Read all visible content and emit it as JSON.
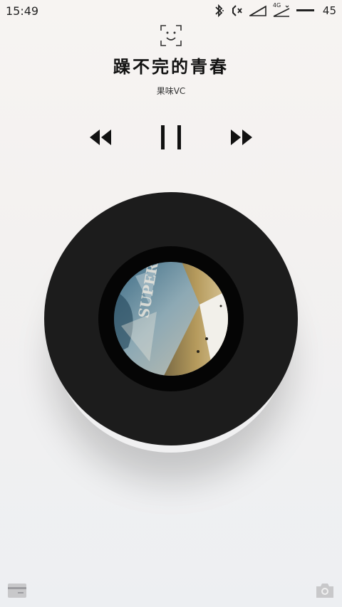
{
  "status_bar": {
    "time": "15:49",
    "signal_label": "4G",
    "battery": "45",
    "icons": [
      "bluetooth-icon",
      "mute-icon",
      "signal-icon",
      "signal-4g-icon",
      "battery-icon"
    ]
  },
  "header": {
    "icon": "face-icon"
  },
  "song": {
    "title": "躁不完的青春",
    "artist": "果味VC"
  },
  "controls": {
    "prev_icon": "rewind-icon",
    "play_state_icon": "pause-icon",
    "next_icon": "fast-forward-icon"
  },
  "disc": {
    "art_icon": "album-art",
    "art_text": "SUPERCO"
  },
  "bottom": {
    "left_icon": "wallet-icon",
    "right_icon": "camera-icon"
  },
  "colors": {
    "disc": "#1c1c1c",
    "disc_ring": "#050505",
    "text": "#111111"
  }
}
